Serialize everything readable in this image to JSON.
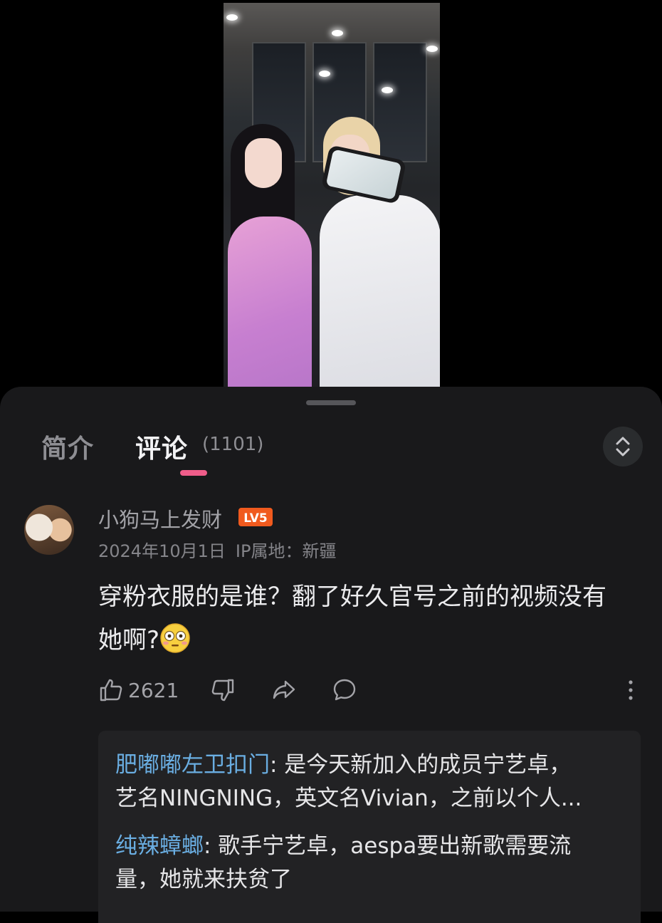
{
  "tabs": {
    "intro_label": "简介",
    "comments_label": "评论",
    "comments_count": "(1101)"
  },
  "comment": {
    "username": "小狗马上发财",
    "level_badge": "LV5",
    "date": "2024年10月1日",
    "ip_label": "IP属地：新疆",
    "text_line1": "穿粉衣服的是谁？翻了好久官号之前的视频没有",
    "text_line2": "她啊?",
    "emoji": "flushed-face",
    "like_count": "2621"
  },
  "replies": [
    {
      "name": "肥嘟嘟左卫扣门",
      "text_line1": ": 是今天新加入的成员宁艺卓，",
      "text_line2": "艺名NINGNING，英文名Vivian，之前以个人..."
    },
    {
      "name": "纯辣蟑螂",
      "text_line1": ": 歌手宁艺卓，aespa要出新歌需要流",
      "text_line2": "量，她就来扶贫了"
    }
  ],
  "colors": {
    "accent_pink": "#f05d8a",
    "level_orange": "#f05a1e",
    "reply_name_blue": "#6aaee2",
    "sheet_bg": "#19191b"
  }
}
